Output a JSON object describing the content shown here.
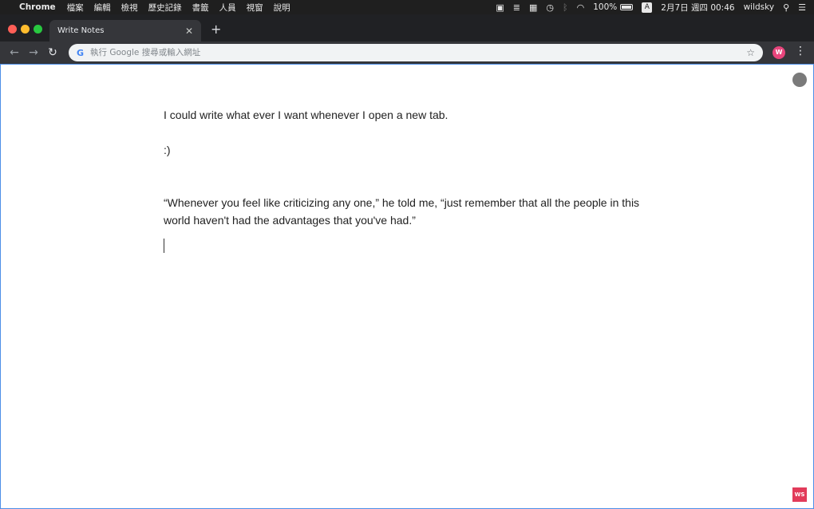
{
  "menubar": {
    "app_name": "Chrome",
    "items": [
      "檔案",
      "編輯",
      "檢視",
      "歷史記錄",
      "書籤",
      "人員",
      "視窗",
      "說明"
    ],
    "battery": "100%",
    "ime": "A",
    "datetime": "2月7日 週四 00:46",
    "user": "wildsky"
  },
  "browser": {
    "tab_title": "Write Notes",
    "omnibox_placeholder": "執行 Google 搜尋或輸入網址",
    "extension_badge": "W"
  },
  "note": {
    "line1": "I could write what ever I want whenever I open a new tab.",
    "line2": ":)",
    "quote": "“Whenever you feel like criticizing any one,” he told me, “just remember that all the people in this world haven't had the advantages that you've had.”"
  },
  "corner_logo_text": "WS"
}
